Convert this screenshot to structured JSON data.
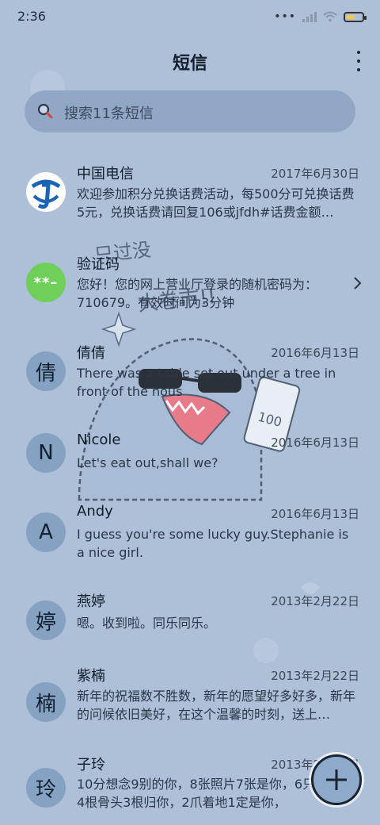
{
  "status_bar": {
    "time": "2:36"
  },
  "header": {
    "title": "短信"
  },
  "search": {
    "placeholder": "搜索11条短信"
  },
  "wallpaper": {
    "text_line1": "只过没",
    "text_line2": "大卷市!!",
    "card_label": "100"
  },
  "messages": [
    {
      "sender": "中国电信",
      "date": "2017年6月30日",
      "preview": "欢迎参加积分兑换话费活动，每500分可兑换话费5元，兑换话费请回复106或jfdh#话费金额…",
      "avatar": "telecom-logo-icon"
    },
    {
      "sender": "验证码",
      "date": "",
      "preview": "您好！您的网上营业厅登录的随机密码为：710679。有效时间为3分钟",
      "avatar_text": "**–"
    },
    {
      "sender": "倩倩",
      "date": "2016年6月13日",
      "preview": "There was a table set out under a tree in front of the hous",
      "avatar_text": "倩"
    },
    {
      "sender": "Nicole",
      "date": "2016年6月13日",
      "preview": "Let's eat out,shall we?",
      "avatar_text": "N"
    },
    {
      "sender": "Andy",
      "date": "2016年6月13日",
      "preview": "I guess you're some lucky guy.Stephanie is a nice girl.",
      "avatar_text": "A"
    },
    {
      "sender": "燕婷",
      "date": "2013年2月22日",
      "preview": "嗯。收到啦。同乐同乐。",
      "avatar_text": "婷"
    },
    {
      "sender": "紫楠",
      "date": "2013年2月22日",
      "preview": "新年的祝福数不胜数，新年的愿望好多好多，新年的问候依旧美好，在这个温馨的时刻，送上…",
      "avatar_text": "楠"
    },
    {
      "sender": "子玲",
      "date": "2013年2月22日",
      "preview": "10分想念9别的你，8张照片7张是你，6只像你，4根骨头3根归你，2爪着地1定是你，",
      "avatar_text": "玲"
    }
  ],
  "colors": {
    "background": "#aebfd8",
    "avatar": "#86a2c3",
    "verify_avatar": "#6ed05a",
    "search_bg": "#90a7c5"
  }
}
